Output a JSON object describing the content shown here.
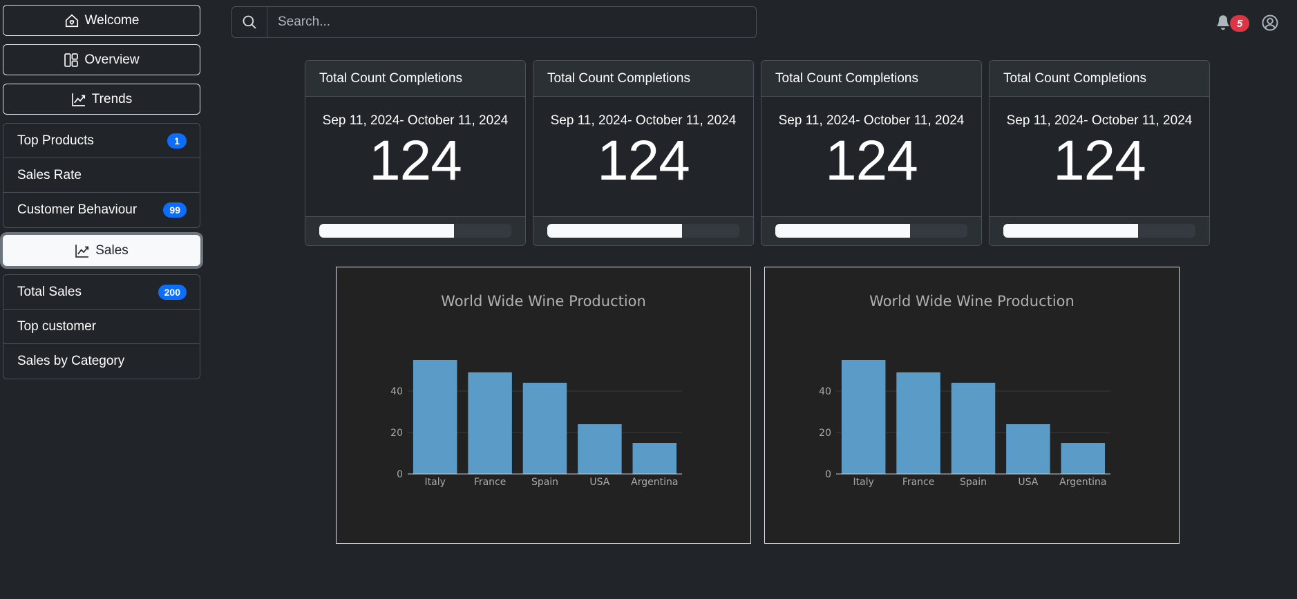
{
  "sidebar": {
    "top_buttons": [
      {
        "label": "Welcome",
        "icon": "house-heart-icon"
      },
      {
        "label": "Overview",
        "icon": "layout-icon"
      },
      {
        "label": "Trends",
        "icon": "graph-up-icon"
      }
    ],
    "group1": [
      {
        "label": "Top Products",
        "badge": "1"
      },
      {
        "label": "Sales Rate",
        "badge": ""
      },
      {
        "label": "Customer Behaviour",
        "badge": "99"
      }
    ],
    "sales_button": {
      "label": "Sales",
      "icon": "graph-up-icon"
    },
    "group2": [
      {
        "label": "Total Sales",
        "badge": "200"
      },
      {
        "label": "Top customer",
        "badge": ""
      },
      {
        "label": "Sales by Category",
        "badge": ""
      }
    ]
  },
  "search": {
    "placeholder": "Search...",
    "value": ""
  },
  "header": {
    "notification_count": "5"
  },
  "cards": [
    {
      "title": "Total Count Completions",
      "date_range": "Sep 11, 2024- October 11, 2024",
      "value": "124",
      "progress": 0.7
    },
    {
      "title": "Total Count Completions",
      "date_range": "Sep 11, 2024- October 11, 2024",
      "value": "124",
      "progress": 0.7
    },
    {
      "title": "Total Count Completions",
      "date_range": "Sep 11, 2024- October 11, 2024",
      "value": "124",
      "progress": 0.7
    },
    {
      "title": "Total Count Completions",
      "date_range": "Sep 11, 2024- October 11, 2024",
      "value": "124",
      "progress": 0.7
    }
  ],
  "colors": {
    "accent": "#0d6efd",
    "danger": "#dc3545",
    "bar": "#5b9bc8"
  },
  "chart_data": [
    {
      "type": "bar",
      "title": "World Wide Wine Production",
      "categories": [
        "Italy",
        "France",
        "Spain",
        "USA",
        "Argentina"
      ],
      "values": [
        55,
        49,
        44,
        24,
        15
      ],
      "yticks": [
        0,
        20,
        40
      ],
      "ylim": [
        0,
        55
      ],
      "xlabel": "",
      "ylabel": "",
      "grid": true
    },
    {
      "type": "bar",
      "title": "World Wide Wine Production",
      "categories": [
        "Italy",
        "France",
        "Spain",
        "USA",
        "Argentina"
      ],
      "values": [
        55,
        49,
        44,
        24,
        15
      ],
      "yticks": [
        0,
        20,
        40
      ],
      "ylim": [
        0,
        55
      ],
      "xlabel": "",
      "ylabel": "",
      "grid": true
    }
  ]
}
